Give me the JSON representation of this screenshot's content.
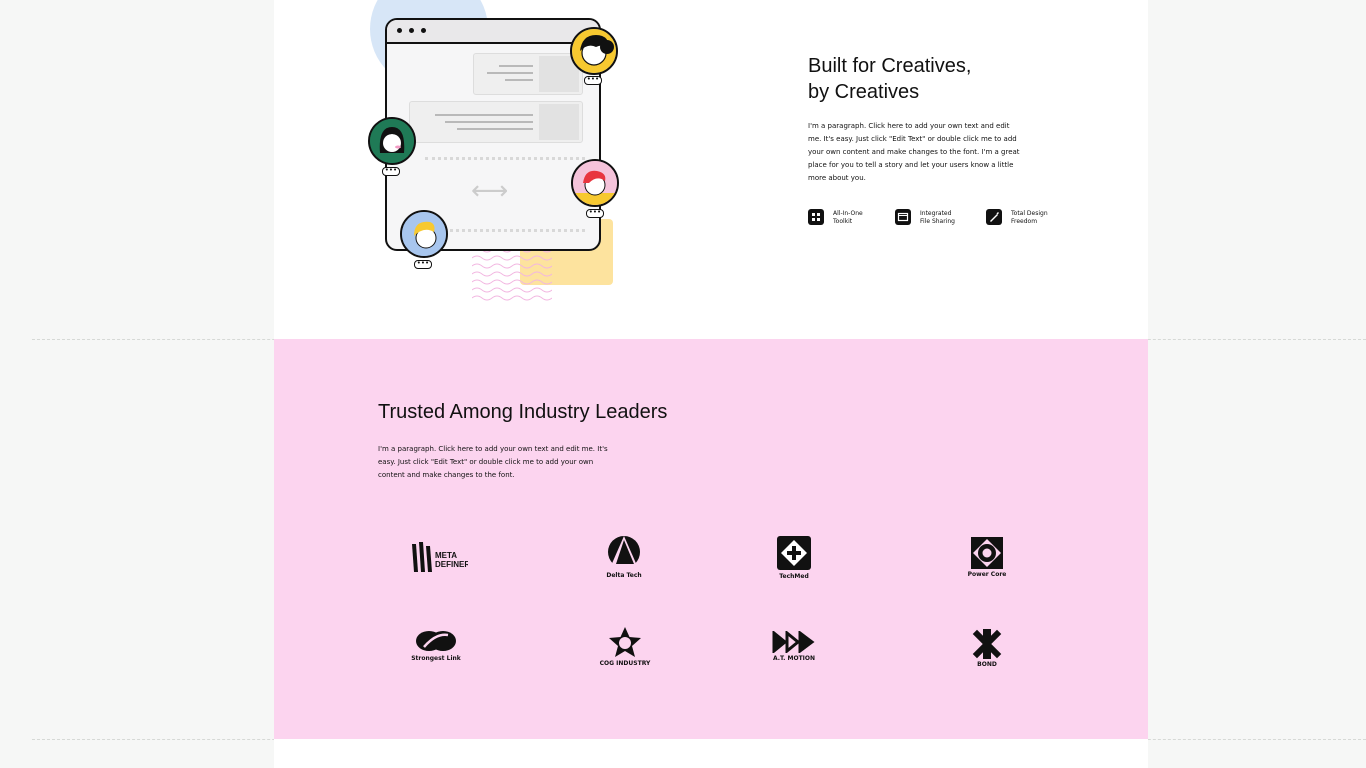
{
  "feature": {
    "title_line1": "Built for Creatives,",
    "title_line2": "by Creatives",
    "paragraph": "I'm a paragraph. Click here to add your own text and edit me. It's easy. Just click \"Edit Text\" or double click me to add your own content and make changes to the font. I'm a great place for you to tell a story and let your users know a little more about you.",
    "items": [
      {
        "line1": "All-In-One",
        "line2": "Toolkit",
        "icon": "grid-icon"
      },
      {
        "line1": "Integrated",
        "line2": "File Sharing",
        "icon": "folder-icon"
      },
      {
        "line1": "Total Design",
        "line2": "Freedom",
        "icon": "pen-icon"
      }
    ]
  },
  "illustration": {
    "bubble_text": "•••",
    "arrow_glyph": "⟷"
  },
  "trusted": {
    "title": "Trusted Among Industry Leaders",
    "paragraph": "I'm a paragraph. Click here to add your own text and edit me. It's easy. Just click \"Edit Text\" or double click me to add your own content and make changes to the font.",
    "logos": [
      {
        "name": "META DEFINER",
        "caption": ""
      },
      {
        "name": "Delta Tech",
        "caption": "Delta Tech"
      },
      {
        "name": "TechMed",
        "caption": "TechMed"
      },
      {
        "name": "Power Core",
        "caption": "Power Core"
      },
      {
        "name": "Strongest Link",
        "caption": "Strongest Link"
      },
      {
        "name": "COG INDUSTRY",
        "caption": "COG INDUSTRY"
      },
      {
        "name": "A.T. MOTION",
        "caption": "A.T. MOTION"
      },
      {
        "name": "BOND",
        "caption": "BOND"
      }
    ],
    "meta_logo_text1": "META",
    "meta_logo_text2": "DEFINER"
  },
  "colors": {
    "pink": "#fcd4ef",
    "yellow": "#fde39e",
    "blue": "#d7e6f7",
    "ink": "#111111"
  }
}
